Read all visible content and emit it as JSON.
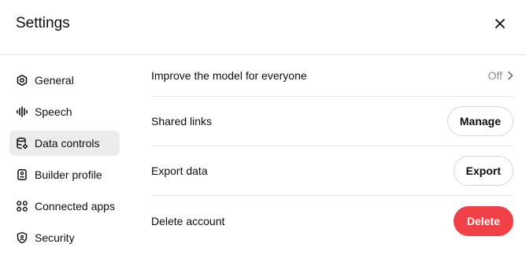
{
  "header": {
    "title": "Settings"
  },
  "sidebar": {
    "items": [
      {
        "label": "General",
        "icon": "gear-icon"
      },
      {
        "label": "Speech",
        "icon": "waveform-icon"
      },
      {
        "label": "Data controls",
        "icon": "database-icon",
        "active": true
      },
      {
        "label": "Builder profile",
        "icon": "id-badge-icon"
      },
      {
        "label": "Connected apps",
        "icon": "apps-grid-icon"
      },
      {
        "label": "Security",
        "icon": "shield-icon"
      }
    ]
  },
  "content": {
    "rows": [
      {
        "label": "Improve the model for everyone",
        "value": "Off"
      },
      {
        "label": "Shared links",
        "button": "Manage"
      },
      {
        "label": "Export data",
        "button": "Export"
      },
      {
        "label": "Delete account",
        "button": "Delete"
      }
    ]
  },
  "colors": {
    "danger": "#ef4146",
    "active_bg": "#ececec",
    "divider": "#e5e5e5",
    "muted_text": "#8f8f8f"
  }
}
